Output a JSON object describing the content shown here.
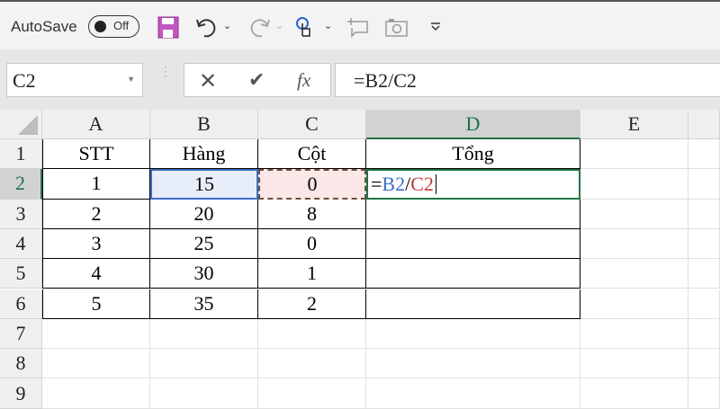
{
  "toolbar": {
    "autosave_label": "AutoSave",
    "toggle_label": "Off"
  },
  "formula_bar": {
    "name_box": "C2",
    "formula": "=B2/C2",
    "fx_label": "fx"
  },
  "columns": [
    "A",
    "B",
    "C",
    "D",
    "E"
  ],
  "rows": [
    "1",
    "2",
    "3",
    "4",
    "5",
    "6",
    "7",
    "8",
    "9"
  ],
  "table": [
    [
      "STT",
      "Hàng",
      "Cột",
      "Tổng"
    ],
    [
      "1",
      "15",
      "0",
      ""
    ],
    [
      "2",
      "20",
      "8",
      ""
    ],
    [
      "3",
      "25",
      "0",
      ""
    ],
    [
      "4",
      "30",
      "1",
      ""
    ],
    [
      "5",
      "35",
      "2",
      ""
    ]
  ],
  "edit": {
    "eq": "=",
    "ref1": "B2",
    "slash": "/",
    "ref2": "C2"
  },
  "colors": {
    "ref1": "#3b6fc4",
    "ref2": "#c0393b",
    "active": "#217346"
  }
}
